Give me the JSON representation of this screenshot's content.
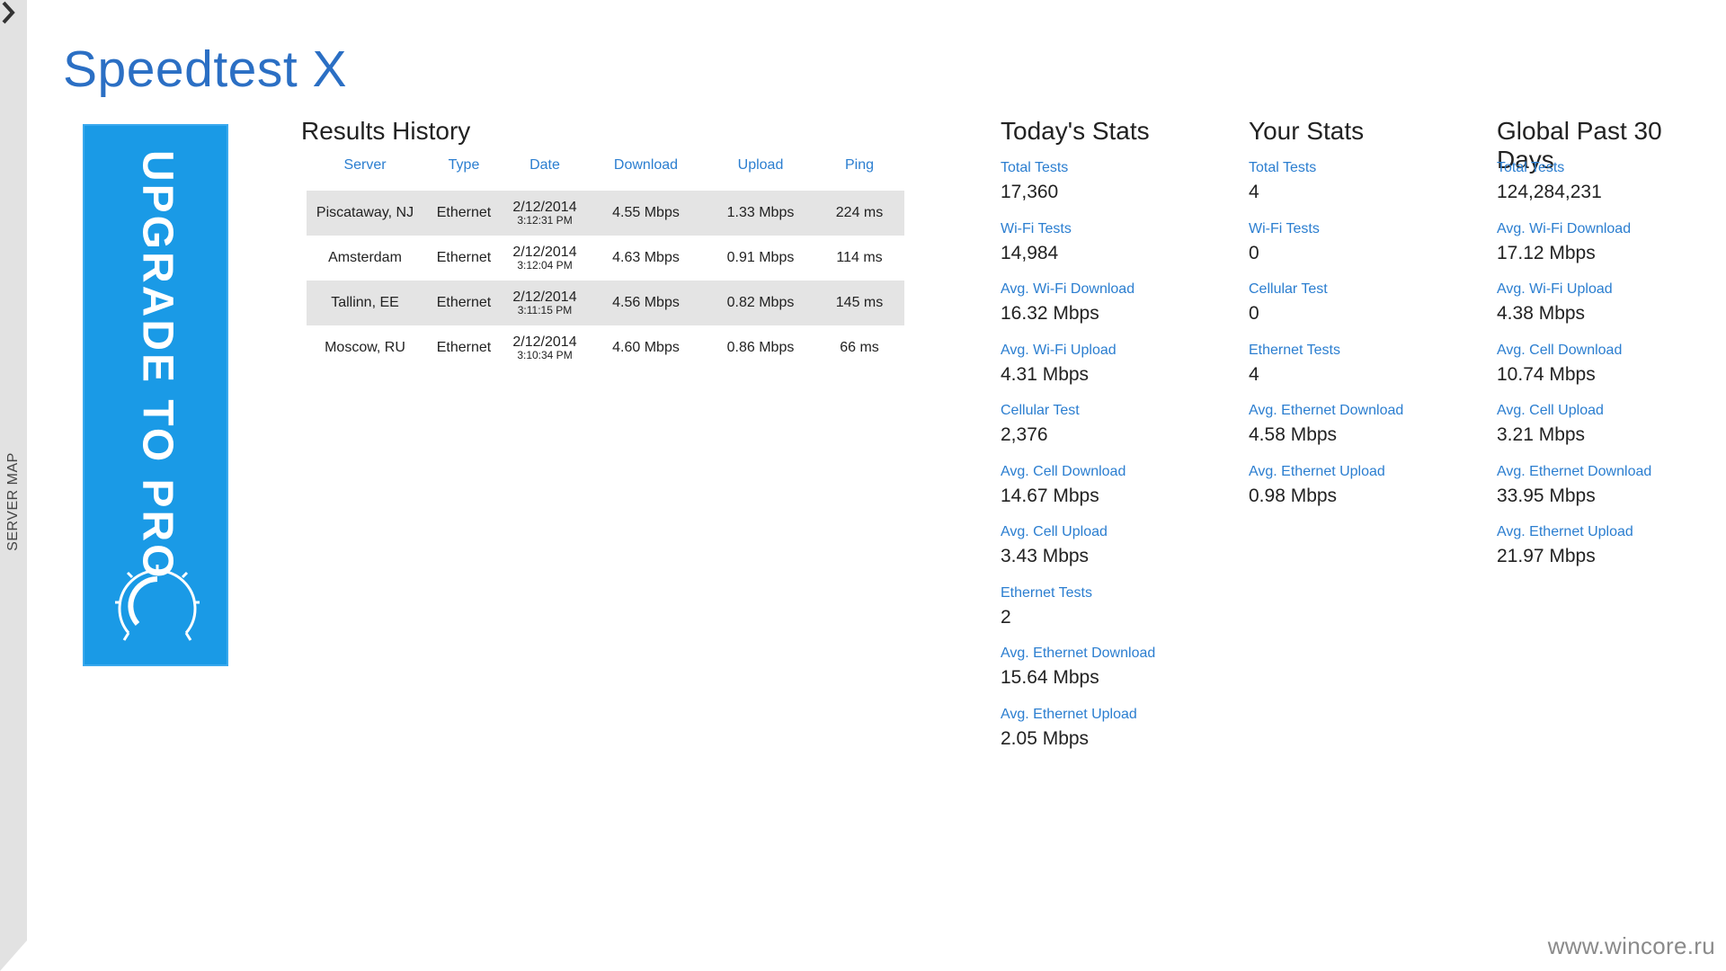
{
  "app": {
    "title": "Speedtest X"
  },
  "side": {
    "label": "SERVER MAP"
  },
  "upgrade": {
    "label": "UPGRADE TO PRO"
  },
  "results": {
    "title": "Results History",
    "columns": [
      "Server",
      "Type",
      "Date",
      "Download",
      "Upload",
      "Ping"
    ],
    "rows": [
      {
        "server": "Piscataway, NJ",
        "type": "Ethernet",
        "date": "2/12/2014",
        "time": "3:12:31 PM",
        "download": "4.55 Mbps",
        "upload": "1.33 Mbps",
        "ping": "224 ms"
      },
      {
        "server": "Amsterdam",
        "type": "Ethernet",
        "date": "2/12/2014",
        "time": "3:12:04 PM",
        "download": "4.63 Mbps",
        "upload": "0.91 Mbps",
        "ping": "114 ms"
      },
      {
        "server": "Tallinn, EE",
        "type": "Ethernet",
        "date": "2/12/2014",
        "time": "3:11:15 PM",
        "download": "4.56 Mbps",
        "upload": "0.82 Mbps",
        "ping": "145 ms"
      },
      {
        "server": "Moscow, RU",
        "type": "Ethernet",
        "date": "2/12/2014",
        "time": "3:10:34 PM",
        "download": "4.60 Mbps",
        "upload": "0.86 Mbps",
        "ping": "66 ms"
      }
    ]
  },
  "today": {
    "title": "Today's Stats",
    "items": [
      {
        "label": "Total Tests",
        "value": "17,360"
      },
      {
        "label": "Wi-Fi Tests",
        "value": "14,984"
      },
      {
        "label": "Avg. Wi-Fi Download",
        "value": "16.32 Mbps"
      },
      {
        "label": "Avg. Wi-Fi Upload",
        "value": "4.31 Mbps"
      },
      {
        "label": "Cellular Test",
        "value": "2,376"
      },
      {
        "label": "Avg. Cell Download",
        "value": "14.67 Mbps"
      },
      {
        "label": "Avg. Cell Upload",
        "value": "3.43 Mbps"
      },
      {
        "label": "Ethernet Tests",
        "value": "2"
      },
      {
        "label": "Avg. Ethernet Download",
        "value": "15.64 Mbps"
      },
      {
        "label": "Avg. Ethernet Upload",
        "value": "2.05 Mbps"
      }
    ]
  },
  "yours": {
    "title": "Your Stats",
    "items": [
      {
        "label": "Total Tests",
        "value": "4"
      },
      {
        "label": "Wi-Fi Tests",
        "value": "0"
      },
      {
        "label": "Cellular Test",
        "value": "0"
      },
      {
        "label": "Ethernet Tests",
        "value": "4"
      },
      {
        "label": "Avg. Ethernet Download",
        "value": "4.58 Mbps"
      },
      {
        "label": "Avg. Ethernet Upload",
        "value": "0.98 Mbps"
      }
    ]
  },
  "global": {
    "title": "Global Past 30 Days",
    "items": [
      {
        "label": "Total Tests",
        "value": "124,284,231"
      },
      {
        "label": "Avg. Wi-Fi Download",
        "value": "17.12 Mbps"
      },
      {
        "label": "Avg. Wi-Fi Upload",
        "value": "4.38 Mbps"
      },
      {
        "label": "Avg. Cell Download",
        "value": "10.74 Mbps"
      },
      {
        "label": "Avg. Cell Upload",
        "value": "3.21 Mbps"
      },
      {
        "label": "Avg. Ethernet Download",
        "value": "33.95 Mbps"
      },
      {
        "label": "Avg. Ethernet Upload",
        "value": "21.97 Mbps"
      }
    ]
  },
  "watermark": "www.wincore.ru",
  "colors": {
    "accent": "#2b7ed0",
    "title": "#2b6fc4",
    "banner": "#1a9ae6",
    "row_shade": "#e4e4e4"
  }
}
